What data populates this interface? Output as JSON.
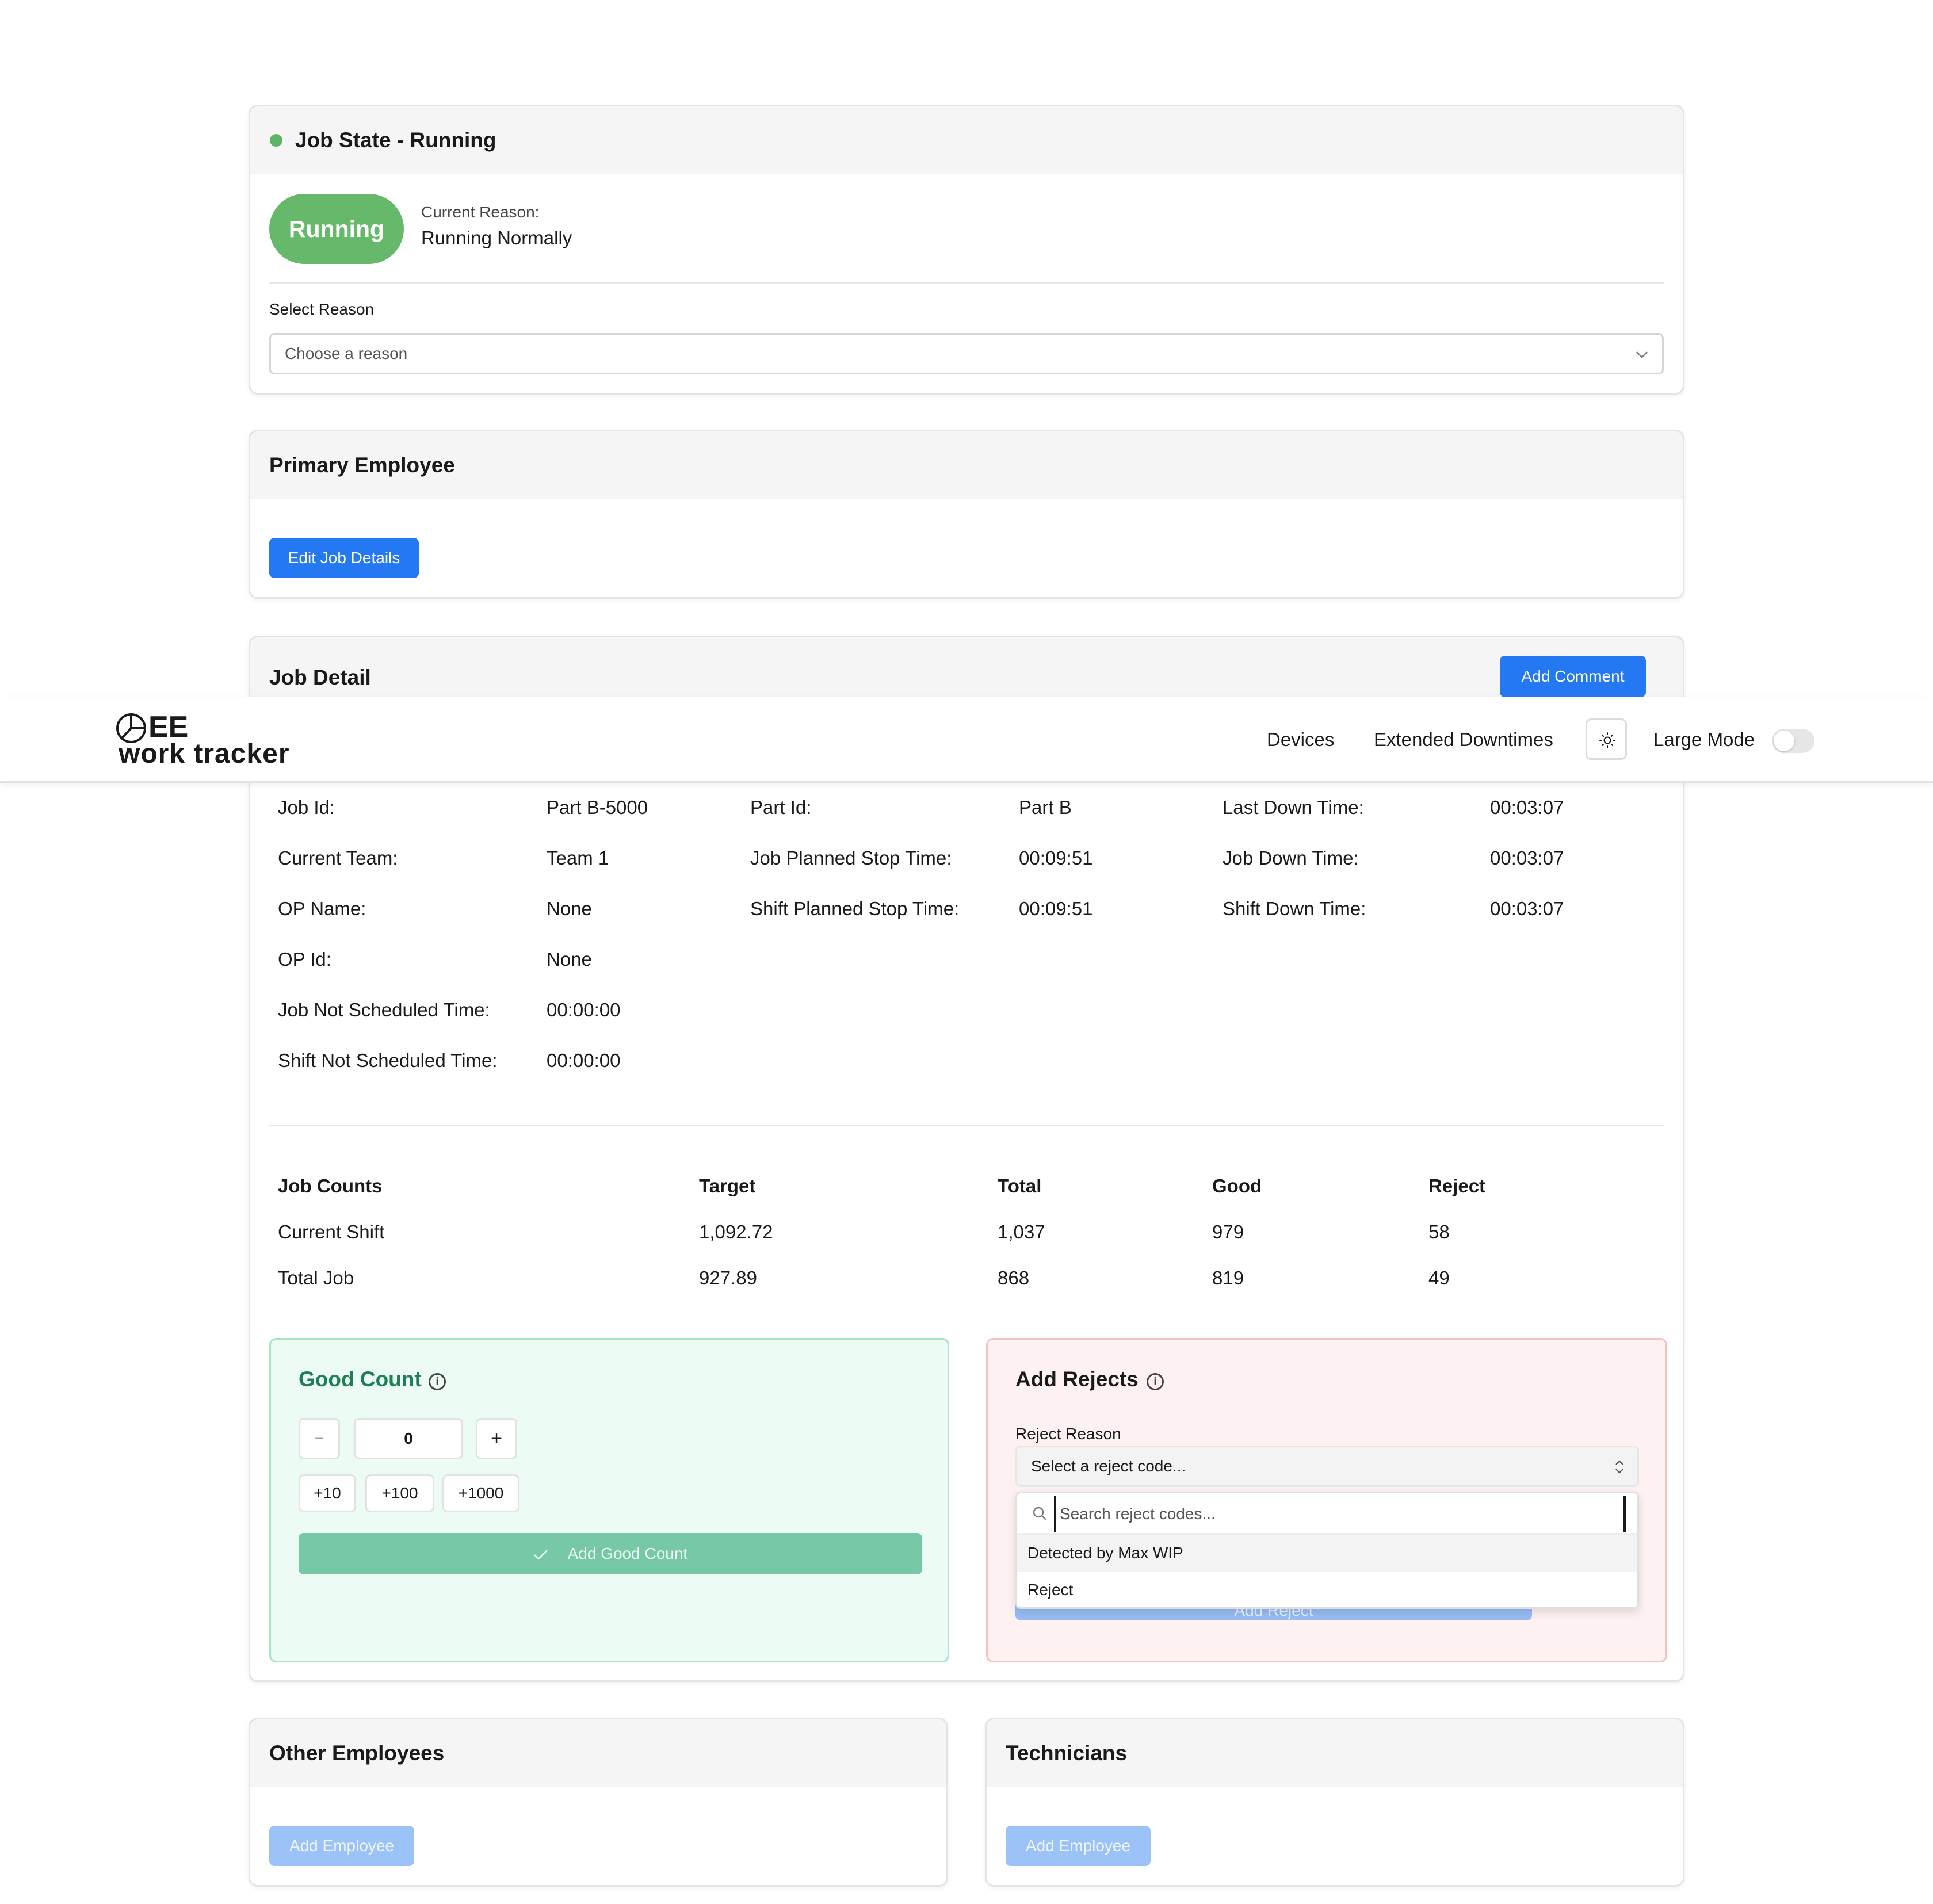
{
  "colors": {
    "primary": "#2478f2",
    "running": "#66b86b",
    "good_panel": "#ecfbf3",
    "reject_panel": "#fdf1f1"
  },
  "nav": {
    "logo_top": "EE",
    "logo_bottom": "work tracker",
    "links": [
      "Devices",
      "Extended Downtimes"
    ],
    "theme_icon": "sun-icon",
    "large_mode_label": "Large Mode",
    "large_mode_on": false
  },
  "job_state": {
    "title": "Job State - Running",
    "status_pill": "Running",
    "current_reason_label": "Current Reason:",
    "current_reason_value": "Running Normally",
    "select_label": "Select Reason",
    "select_placeholder": "Choose a reason"
  },
  "primary_employee": {
    "title": "Primary Employee",
    "edit_button": "Edit Job Details"
  },
  "job_detail": {
    "title": "Job Detail",
    "add_comment_button": "Add Comment",
    "col1": [
      {
        "label": "Job Id:",
        "value": "Part B-5000"
      },
      {
        "label": "Current Team:",
        "value": "Team 1"
      },
      {
        "label": "OP Name:",
        "value": "None"
      },
      {
        "label": "OP Id:",
        "value": "None"
      },
      {
        "label": "Job Not Scheduled Time:",
        "value": "00:00:00"
      },
      {
        "label": "Shift Not Scheduled Time:",
        "value": "00:00:00"
      }
    ],
    "col2": [
      {
        "label": "Part Id:",
        "value": "Part B"
      },
      {
        "label": "Job Planned Stop Time:",
        "value": "00:09:51"
      },
      {
        "label": "Shift Planned Stop Time:",
        "value": "00:09:51"
      }
    ],
    "col3": [
      {
        "label": "Last Down Time:",
        "value": "00:03:07"
      },
      {
        "label": "Job Down Time:",
        "value": "00:03:07"
      },
      {
        "label": "Shift Down Time:",
        "value": "00:03:07"
      }
    ],
    "counts": {
      "headers": [
        "Job Counts",
        "Target",
        "Total",
        "Good",
        "Reject"
      ],
      "rows": [
        [
          "Current Shift",
          "1,092.72",
          "1,037",
          "979",
          "58"
        ],
        [
          "Total Job",
          "927.89",
          "868",
          "819",
          "49"
        ]
      ]
    }
  },
  "good_count": {
    "title": "Good Count",
    "minus": "−",
    "value": "0",
    "plus": "+",
    "quick": [
      "+10",
      "+100",
      "+1000"
    ],
    "submit": "Add Good Count"
  },
  "rejects": {
    "title": "Add Rejects",
    "reason_label": "Reject Reason",
    "select_placeholder": "Select a reject code...",
    "search_placeholder": "Search reject codes...",
    "options": [
      "Detected by Max WIP",
      "Reject"
    ],
    "submit": "Add Reject"
  },
  "other_employees": {
    "title": "Other Employees",
    "add_button": "Add Employee"
  },
  "technicians": {
    "title": "Technicians",
    "add_button": "Add Employee"
  }
}
